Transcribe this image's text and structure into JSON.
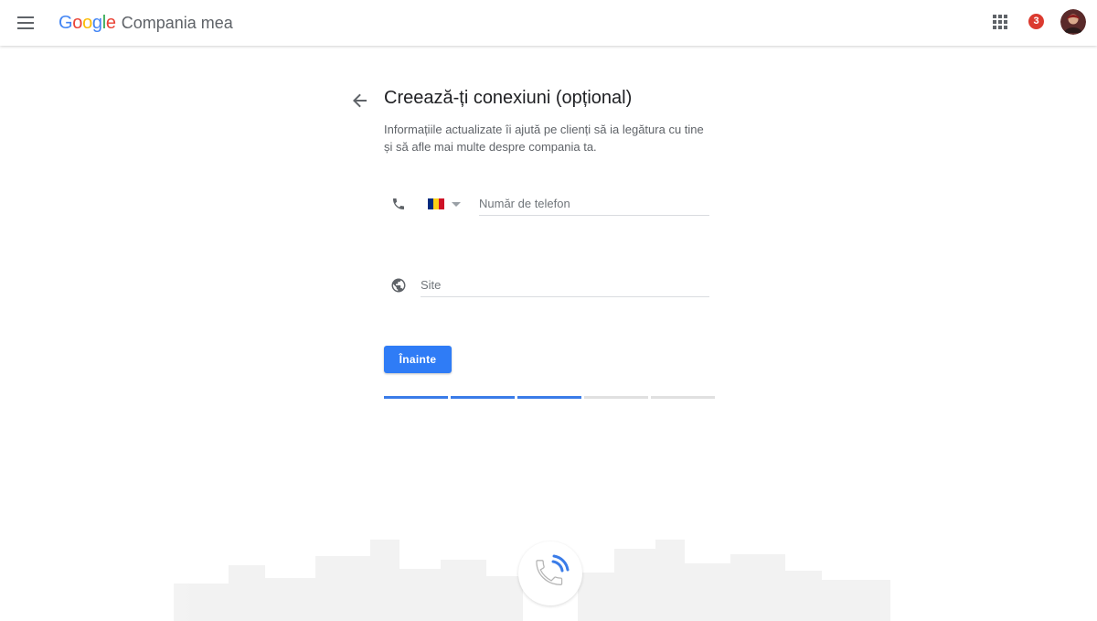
{
  "header": {
    "menu_icon": "hamburger-menu-icon",
    "logo_text": "Google",
    "logo_colors": [
      "#4285F4",
      "#EA4335",
      "#FBBC05",
      "#4285F4",
      "#34A853",
      "#EA4335"
    ],
    "product_name": "Compania mea",
    "apps_icon": "apps-grid-icon",
    "notification_count": "3",
    "avatar_icon": "user-avatar"
  },
  "page": {
    "back_icon": "arrow-back-icon",
    "title": "Creează-ți conexiuni (opțional)",
    "subtitle": "Informațiile actualizate îi ajută pe clienți să ia legătura cu tine și să afle mai multe despre compania ta."
  },
  "form": {
    "phone": {
      "icon": "phone-icon",
      "country_flag": "Romania",
      "flag_colors": [
        "#002B7F",
        "#FCD116",
        "#CE1126"
      ],
      "placeholder": "Număr de telefon",
      "value": ""
    },
    "website": {
      "icon": "globe-icon",
      "placeholder": "Site",
      "value": ""
    },
    "next_label": "Înainte"
  },
  "progress": {
    "total_steps": 5,
    "completed_steps": 3,
    "color_done": "#3a7ce8",
    "color_todo": "#e0e0e0"
  },
  "colors": {
    "primary_button": "#2f7cf6",
    "badge": "#db3a2f"
  }
}
